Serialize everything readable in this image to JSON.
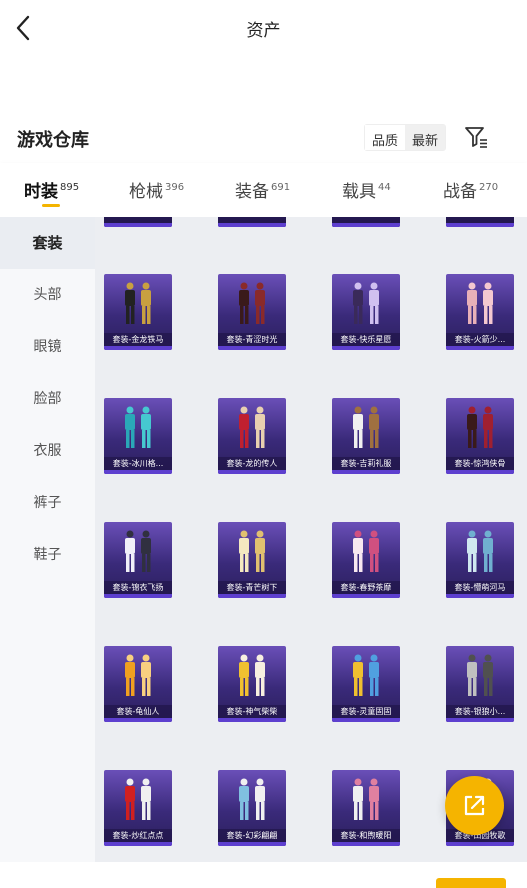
{
  "header": {
    "title": "资产",
    "back_icon": "chevron-left-icon"
  },
  "warehouse": {
    "title": "游戏仓库",
    "sort_options": [
      "品质",
      "最新"
    ],
    "filter_icon": "filter-icon"
  },
  "tabs": [
    {
      "label": "时装",
      "count": "895",
      "active": true
    },
    {
      "label": "枪械",
      "count": "396",
      "active": false
    },
    {
      "label": "装备",
      "count": "691",
      "active": false
    },
    {
      "label": "载具",
      "count": "44",
      "active": false
    },
    {
      "label": "战备",
      "count": "270",
      "active": false
    }
  ],
  "sidebar": {
    "items": [
      {
        "label": "套装",
        "active": true
      },
      {
        "label": "头部"
      },
      {
        "label": "眼镜"
      },
      {
        "label": "脸部"
      },
      {
        "label": "衣服"
      },
      {
        "label": "裤子"
      },
      {
        "label": "鞋子"
      }
    ]
  },
  "items": [
    "套装-金龙铁马",
    "套装-青涩时光",
    "套装-快乐星愿",
    "套装-火箭少...",
    "套装-冰川格...",
    "套装-龙的传人",
    "套装-吉莉礼服",
    "套装-惊鸿侠骨",
    "套装-锦衣飞扬",
    "套装-青芒树下",
    "套装-春野茶靡",
    "套装-懵萌河马",
    "套装-龟仙人",
    "套装-神气柴柴",
    "套装-灵童固固",
    "套装-银狼小...",
    "套装-炒红点点",
    "套装-幻彩翩翩",
    "套装-和煦暖阳",
    "套装-田园牧歌"
  ],
  "colors": {
    "accent": "#f5b400",
    "card_top": "#6a4fb8",
    "card_bottom": "#2b1f5c"
  },
  "fab_icon": "share-icon"
}
